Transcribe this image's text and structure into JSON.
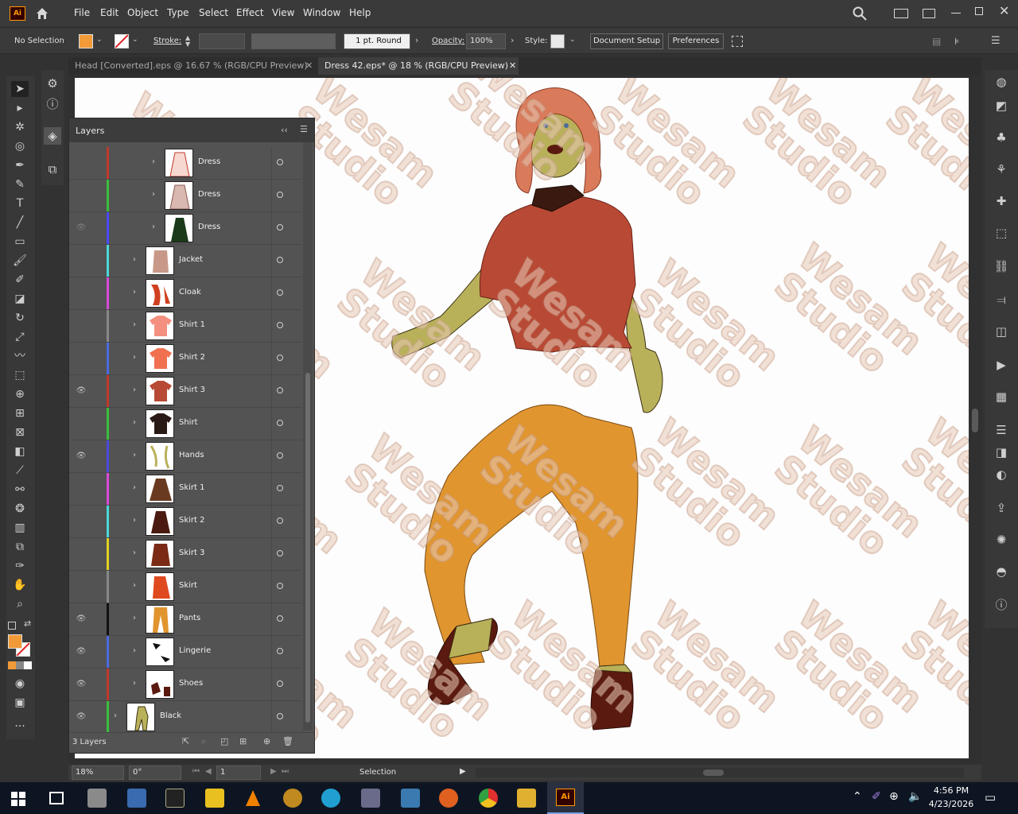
{
  "app": {
    "logo": "Ai"
  },
  "menu": [
    "File",
    "Edit",
    "Object",
    "Type",
    "Select",
    "Effect",
    "View",
    "Window",
    "Help"
  ],
  "control": {
    "selection": "No Selection",
    "stroke_label": "Stroke:",
    "brush": "1 pt. Round",
    "opacity_label": "Opacity:",
    "opacity_value": "100%",
    "style_label": "Style:",
    "doc_setup": "Document Setup",
    "preferences": "Preferences",
    "fill_color": "#f29a38"
  },
  "tabs": [
    {
      "label": "Head [Converted].eps @ 16.67 % (RGB/CPU Preview)",
      "active": false
    },
    {
      "label": "Dress 42.eps* @ 18 % (RGB/CPU Preview)",
      "active": true
    }
  ],
  "layers_panel": {
    "title": "Layers",
    "count": "3 Layers",
    "rows": [
      {
        "name": "Dress",
        "color": "#c0392b",
        "visible": false,
        "thumb": "dress1"
      },
      {
        "name": "Dress",
        "color": "#3bbf3b",
        "visible": false,
        "thumb": "dress2"
      },
      {
        "name": "Dress",
        "color": "#4a4aff",
        "visible": "dim",
        "thumb": "dress3"
      },
      {
        "name": "Jacket",
        "color": "#4ad9d9",
        "visible": false,
        "thumb": "jacket"
      },
      {
        "name": "Cloak",
        "color": "#d94ad9",
        "visible": false,
        "thumb": "cloak"
      },
      {
        "name": "Shirt 1",
        "color": "#888888",
        "visible": false,
        "thumb": "shirt1"
      },
      {
        "name": "Shirt 2",
        "color": "#4a6ae0",
        "visible": false,
        "thumb": "shirt2"
      },
      {
        "name": "Shirt 3",
        "color": "#c0392b",
        "visible": true,
        "thumb": "shirt3"
      },
      {
        "name": "Shirt",
        "color": "#3bbf3b",
        "visible": false,
        "thumb": "shirt"
      },
      {
        "name": "Hands",
        "color": "#4a4ae0",
        "visible": true,
        "thumb": "hands"
      },
      {
        "name": "Skirt 1",
        "color": "#d94ad9",
        "visible": false,
        "thumb": "skirt1"
      },
      {
        "name": "Skirt 2",
        "color": "#4ad9d9",
        "visible": false,
        "thumb": "skirt2"
      },
      {
        "name": "Skirt 3",
        "color": "#e0d020",
        "visible": false,
        "thumb": "skirt3"
      },
      {
        "name": "Skirt",
        "color": "#888888",
        "visible": false,
        "thumb": "skirt"
      },
      {
        "name": "Pants",
        "color": "#111111",
        "visible": true,
        "thumb": "pants"
      },
      {
        "name": "Lingerie",
        "color": "#4a6ae0",
        "visible": true,
        "thumb": "lingerie"
      },
      {
        "name": "Shoes",
        "color": "#c0392b",
        "visible": true,
        "thumb": "shoes"
      },
      {
        "name": "Black",
        "color": "#3bbf3b",
        "visible": true,
        "thumb": "black"
      }
    ]
  },
  "watermark": "Wesam\nStudio",
  "status": {
    "zoom": "18%",
    "rotation": "0°",
    "page": "1",
    "tool": "Selection"
  },
  "clock": {
    "time": "4:56 PM",
    "date": "4/23/2026"
  }
}
